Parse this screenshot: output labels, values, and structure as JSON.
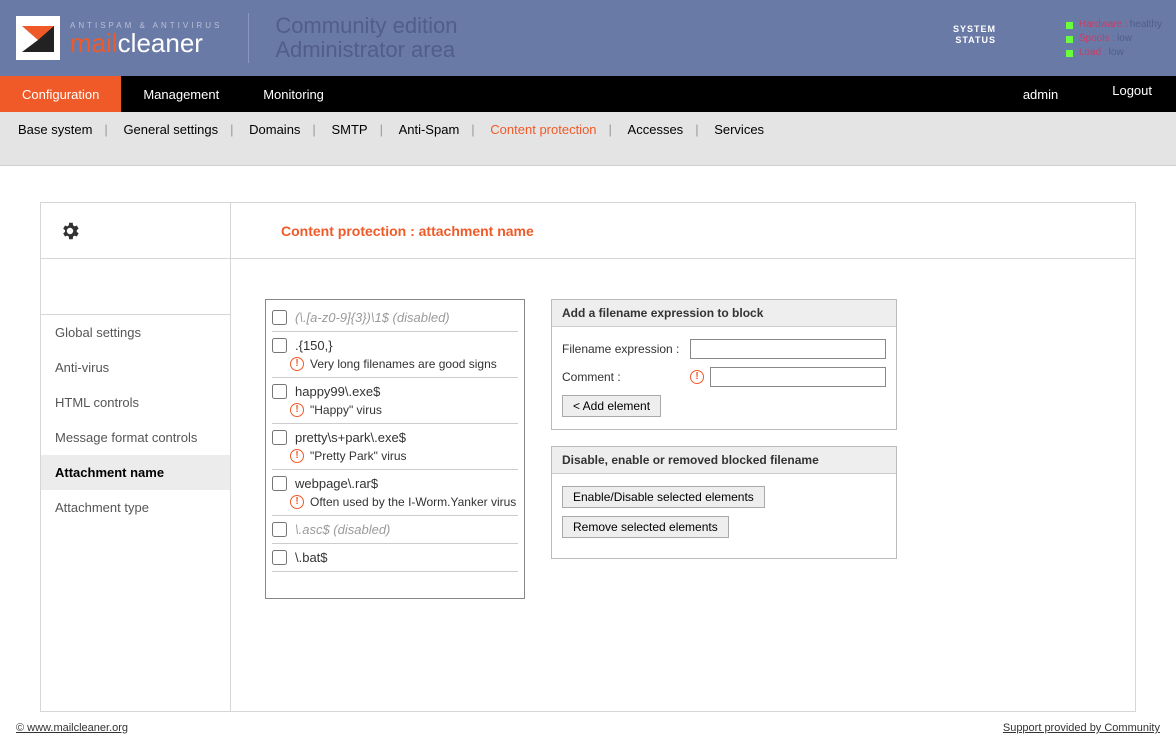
{
  "header": {
    "logo_top": "ANTISPAM & ANTIVIRUS",
    "logo_mail": "mail",
    "logo_cleaner": "cleaner",
    "edition_line1": "Community edition",
    "edition_line2": "Administrator area",
    "system_label_1": "SYSTEM",
    "system_label_2": "STATUS",
    "status": [
      {
        "key": "Hardware :",
        "val": "healthy"
      },
      {
        "key": "Spools :",
        "val": "low"
      },
      {
        "key": "Load :",
        "val": "low"
      }
    ]
  },
  "nav": {
    "items": [
      "Configuration",
      "Management",
      "Monitoring"
    ],
    "active": "Configuration",
    "user": "admin",
    "logout": "Logout"
  },
  "subnav": {
    "items": [
      "Base system",
      "General settings",
      "Domains",
      "SMTP",
      "Anti-Spam",
      "Content protection",
      "Accesses",
      "Services"
    ],
    "active": "Content protection"
  },
  "side": {
    "items": [
      "Global settings",
      "Anti-virus",
      "HTML controls",
      "Message format controls",
      "Attachment name",
      "Attachment type"
    ],
    "active": "Attachment name"
  },
  "page_title": "Content protection : attachment name",
  "list": [
    {
      "expr": "(\\.[a-z0-9]{3})\\1$ (disabled)",
      "disabled": true,
      "comment": ""
    },
    {
      "expr": ".{150,}",
      "disabled": false,
      "comment": "Very long filenames are good signs"
    },
    {
      "expr": "happy99\\.exe$",
      "disabled": false,
      "comment": "\"Happy\" virus"
    },
    {
      "expr": "pretty\\s+park\\.exe$",
      "disabled": false,
      "comment": "\"Pretty Park\" virus"
    },
    {
      "expr": "webpage\\.rar$",
      "disabled": false,
      "comment": "Often used by the I-Worm.Yanker virus"
    },
    {
      "expr": "\\.asc$ (disabled)",
      "disabled": true,
      "comment": ""
    },
    {
      "expr": "\\.bat$",
      "disabled": false,
      "comment": ""
    }
  ],
  "form": {
    "add_title": "Add a filename expression to block",
    "label_expr": "Filename expression :",
    "label_comment": "Comment :",
    "btn_add": "< Add element",
    "manage_title": "Disable, enable or removed blocked filename",
    "btn_toggle": "Enable/Disable selected elements",
    "btn_remove": "Remove selected elements"
  },
  "footer": {
    "left": "© www.mailcleaner.org",
    "right": "Support provided by Community"
  }
}
